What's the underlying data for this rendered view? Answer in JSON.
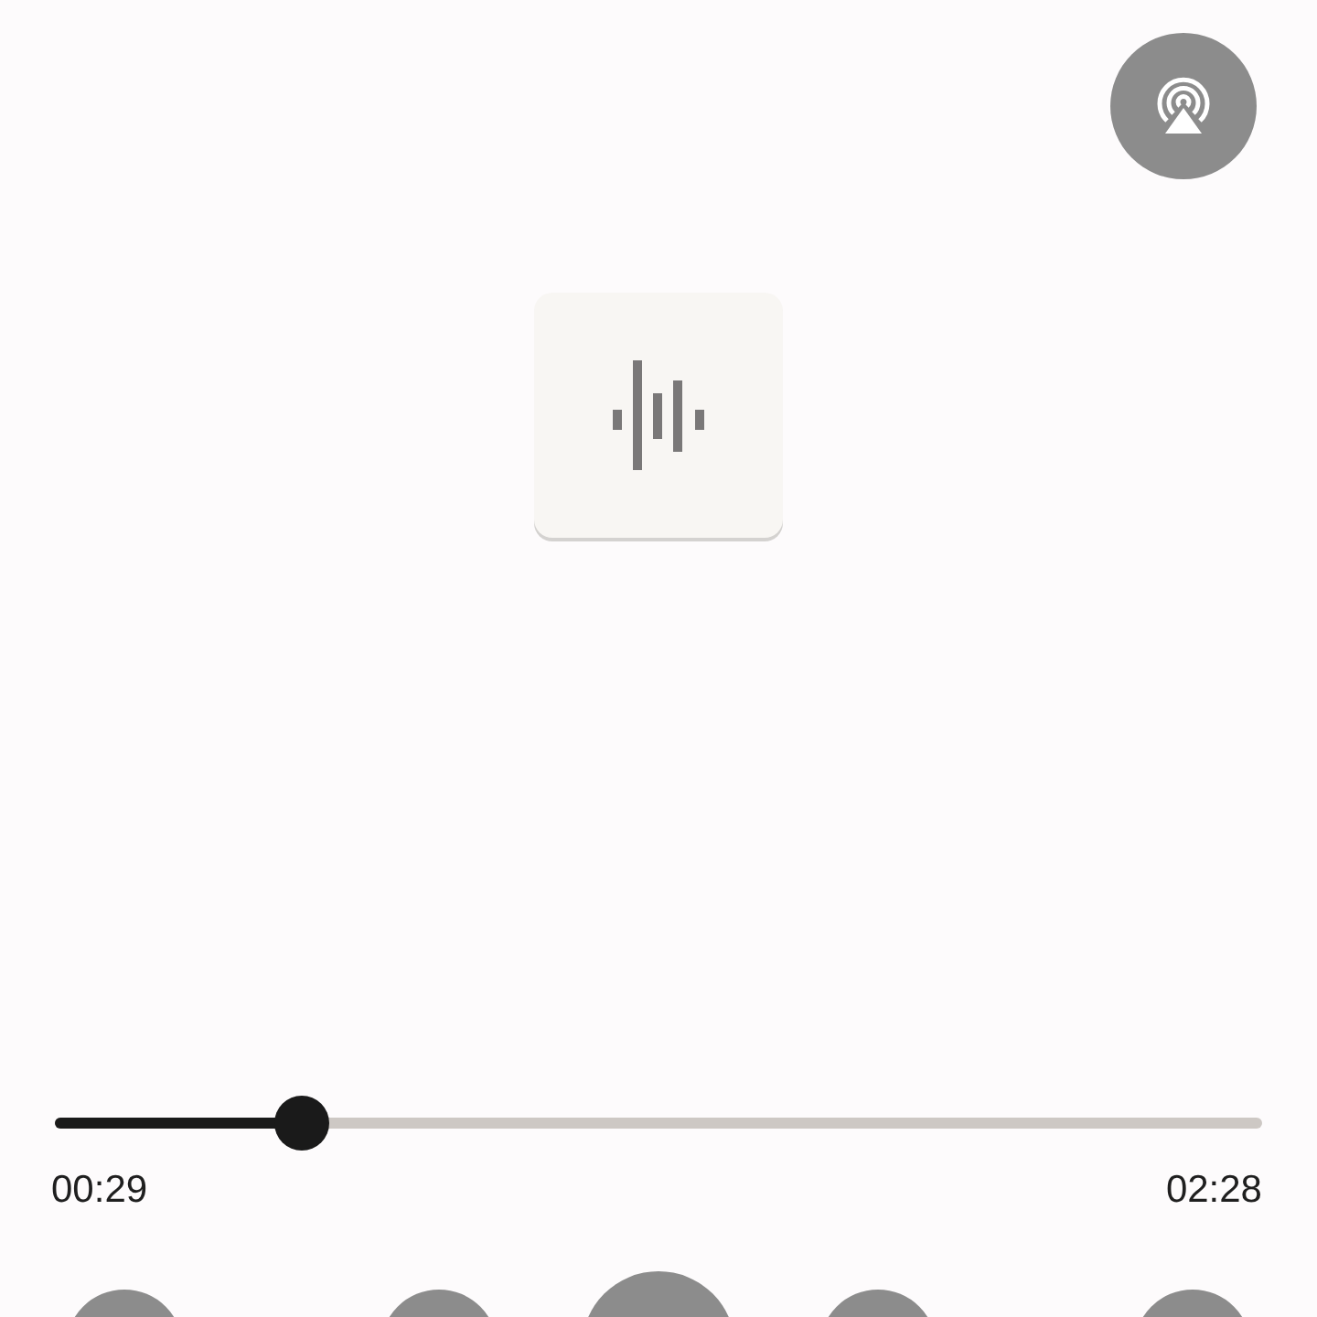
{
  "player": {
    "progress": {
      "level": 0.205
    },
    "elapsed": "00:29",
    "duration": "02:28"
  },
  "controls": [
    {
      "kind": "secondary"
    },
    {
      "kind": "secondary"
    },
    {
      "kind": "main"
    },
    {
      "kind": "secondary"
    },
    {
      "kind": "secondary"
    }
  ]
}
